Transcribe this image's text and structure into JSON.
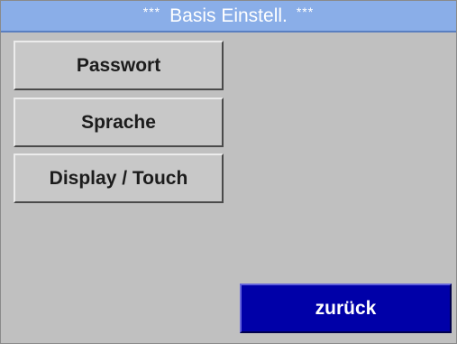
{
  "header": {
    "stars_left": "***",
    "title": "Basis Einstell.",
    "stars_right": "***"
  },
  "menu": {
    "items": [
      {
        "label": "Passwort"
      },
      {
        "label": "Sprache"
      },
      {
        "label": "Display / Touch"
      }
    ]
  },
  "footer": {
    "back_label": "zurück"
  },
  "colors": {
    "title_bar": "#8aaee8",
    "background": "#c0c0c0",
    "button_face": "#c8c8c8",
    "back_button": "#0000a8"
  }
}
